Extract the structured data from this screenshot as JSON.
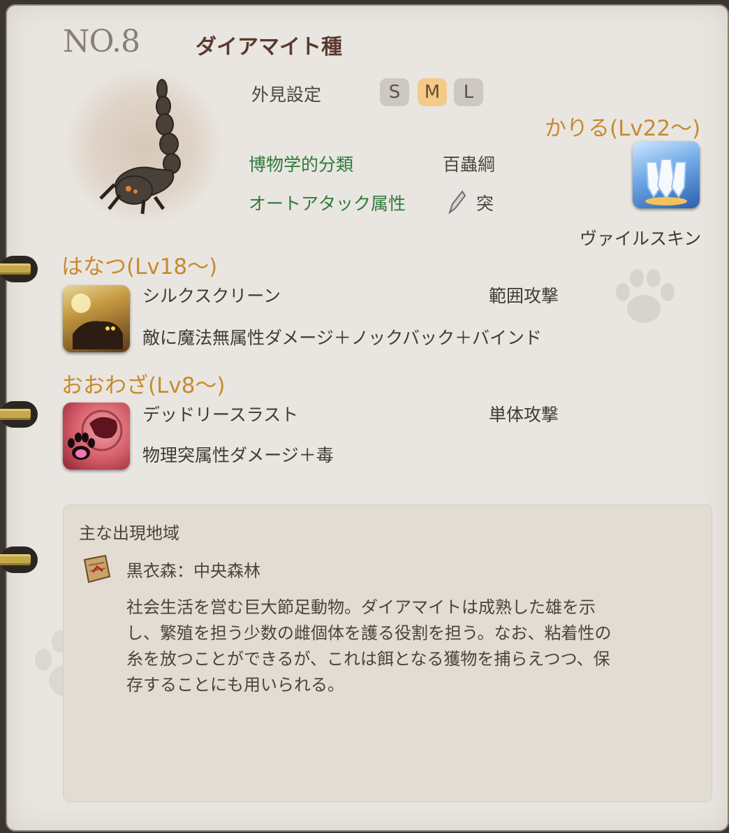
{
  "header": {
    "number": "NO.8",
    "title": "ダイアマイト種"
  },
  "appearance": {
    "label": "外見設定",
    "sizes": [
      "S",
      "M",
      "L"
    ],
    "selected": "M"
  },
  "classification": {
    "label": "博物学的分類",
    "value": "百蟲綱"
  },
  "auto_attack": {
    "label": "オートアタック属性",
    "icon": "piercing-icon",
    "value": "突"
  },
  "kariru": {
    "header": "かりる(Lv22～)",
    "skill_name": "ヴァイルスキン",
    "icon": "shield-crystal-icon"
  },
  "hanatsu": {
    "header": "はなつ(Lv18～)",
    "skill_name": "シルクスクリーン",
    "type": "範囲攻撃",
    "description": "敵に魔法無属性ダメージ＋ノックバック＋バインド",
    "icon": "silk-screen-icon"
  },
  "oowaza": {
    "header": "おおわざ(Lv8～)",
    "skill_name": "デッドリースラスト",
    "type": "単体攻撃",
    "description": "物理突属性ダメージ＋毒",
    "icon": "beast-paw-icon"
  },
  "habitat": {
    "label": "主な出現地域",
    "location": "黒衣森：中央森林",
    "lines": [
      "社会生活を営む巨大節足動物。ダイアマイトは成熟した雄を示",
      "し、繁殖を担う少数の雌個体を護る役割を担う。なお、粘着性の",
      "糸を放つことができるが、これは餌となる獲物を捕らえつつ、保",
      "存することにも用いられる。"
    ]
  }
}
